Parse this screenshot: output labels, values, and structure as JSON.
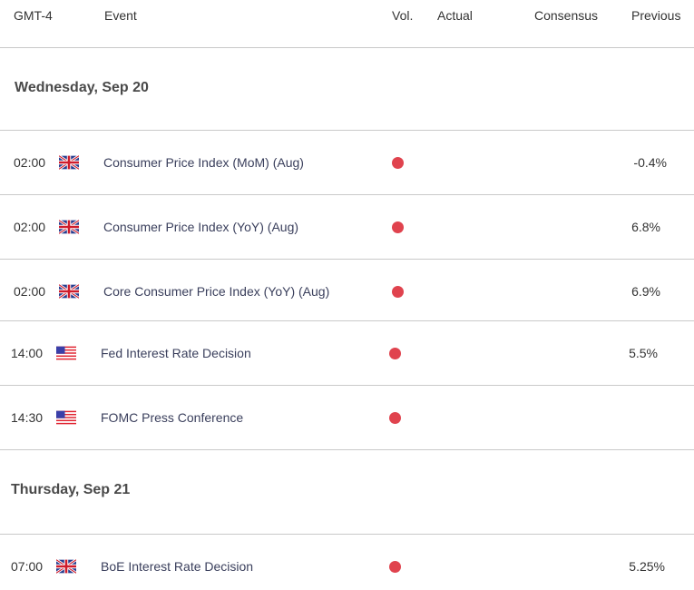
{
  "header": {
    "timezone": "GMT-4",
    "event": "Event",
    "vol": "Vol.",
    "actual": "Actual",
    "consensus": "Consensus",
    "previous": "Previous"
  },
  "colors": {
    "volatility_high": "#e0434e",
    "divider": "#c9c9c9"
  },
  "days": [
    {
      "label": "Wednesday, Sep 20",
      "events": [
        {
          "time": "02:00",
          "country": "uk-flag-icon",
          "event": "Consumer Price Index (MoM) (Aug)",
          "vol": "high",
          "actual": "",
          "consensus": "",
          "previous": "-0.4%"
        },
        {
          "time": "02:00",
          "country": "uk-flag-icon",
          "event": "Consumer Price Index (YoY) (Aug)",
          "vol": "high",
          "actual": "",
          "consensus": "",
          "previous": "6.8%"
        },
        {
          "time": "02:00",
          "country": "uk-flag-icon",
          "event": "Core Consumer Price Index (YoY) (Aug)",
          "vol": "high",
          "actual": "",
          "consensus": "",
          "previous": "6.9%"
        },
        {
          "time": "14:00",
          "country": "us-flag-icon",
          "event": "Fed Interest Rate Decision",
          "vol": "high",
          "actual": "",
          "consensus": "",
          "previous": "5.5%"
        },
        {
          "time": "14:30",
          "country": "us-flag-icon",
          "event": "FOMC Press Conference",
          "vol": "high",
          "actual": "",
          "consensus": "",
          "previous": ""
        }
      ]
    },
    {
      "label": "Thursday, Sep 21",
      "events": [
        {
          "time": "07:00",
          "country": "uk-flag-icon",
          "event": "BoE Interest Rate Decision",
          "vol": "high",
          "actual": "",
          "consensus": "",
          "previous": "5.25%"
        }
      ]
    }
  ]
}
